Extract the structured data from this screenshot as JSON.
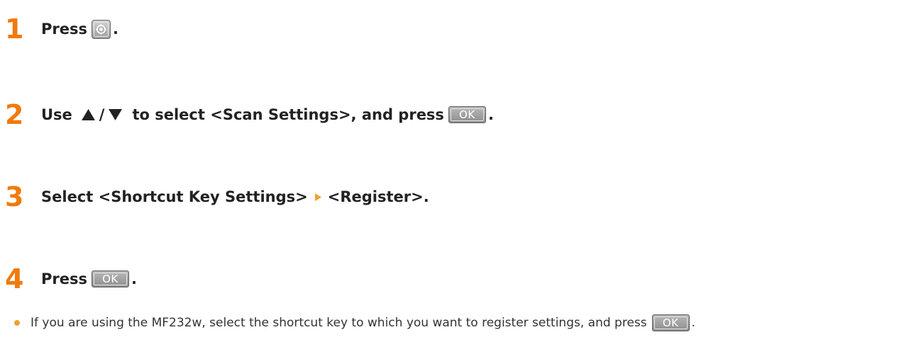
{
  "colors": {
    "step_number": "#f07a0c",
    "text": "#222222",
    "bullet": "#f0a030",
    "menu_arrow": "#f0a030"
  },
  "steps": [
    {
      "number": "1",
      "parts": [
        "Press",
        "."
      ],
      "key_icon": "menu-key-icon"
    },
    {
      "number": "2",
      "parts": [
        "Use",
        "/",
        "to select <Scan Settings>, and press",
        "."
      ],
      "key_label": "OK",
      "arrow_icons": [
        "up-arrow-icon",
        "down-arrow-icon"
      ]
    },
    {
      "number": "3",
      "parts": [
        "Select <Shortcut Key Settings>",
        "<Register>."
      ],
      "separator_icon": "triangle-right-icon"
    },
    {
      "number": "4",
      "parts": [
        "Press",
        "."
      ],
      "key_label": "OK"
    }
  ],
  "note": {
    "text": "If you are using the MF232w, select the shortcut key to which you want to register settings, and press",
    "end": ".",
    "key_label": "OK"
  }
}
